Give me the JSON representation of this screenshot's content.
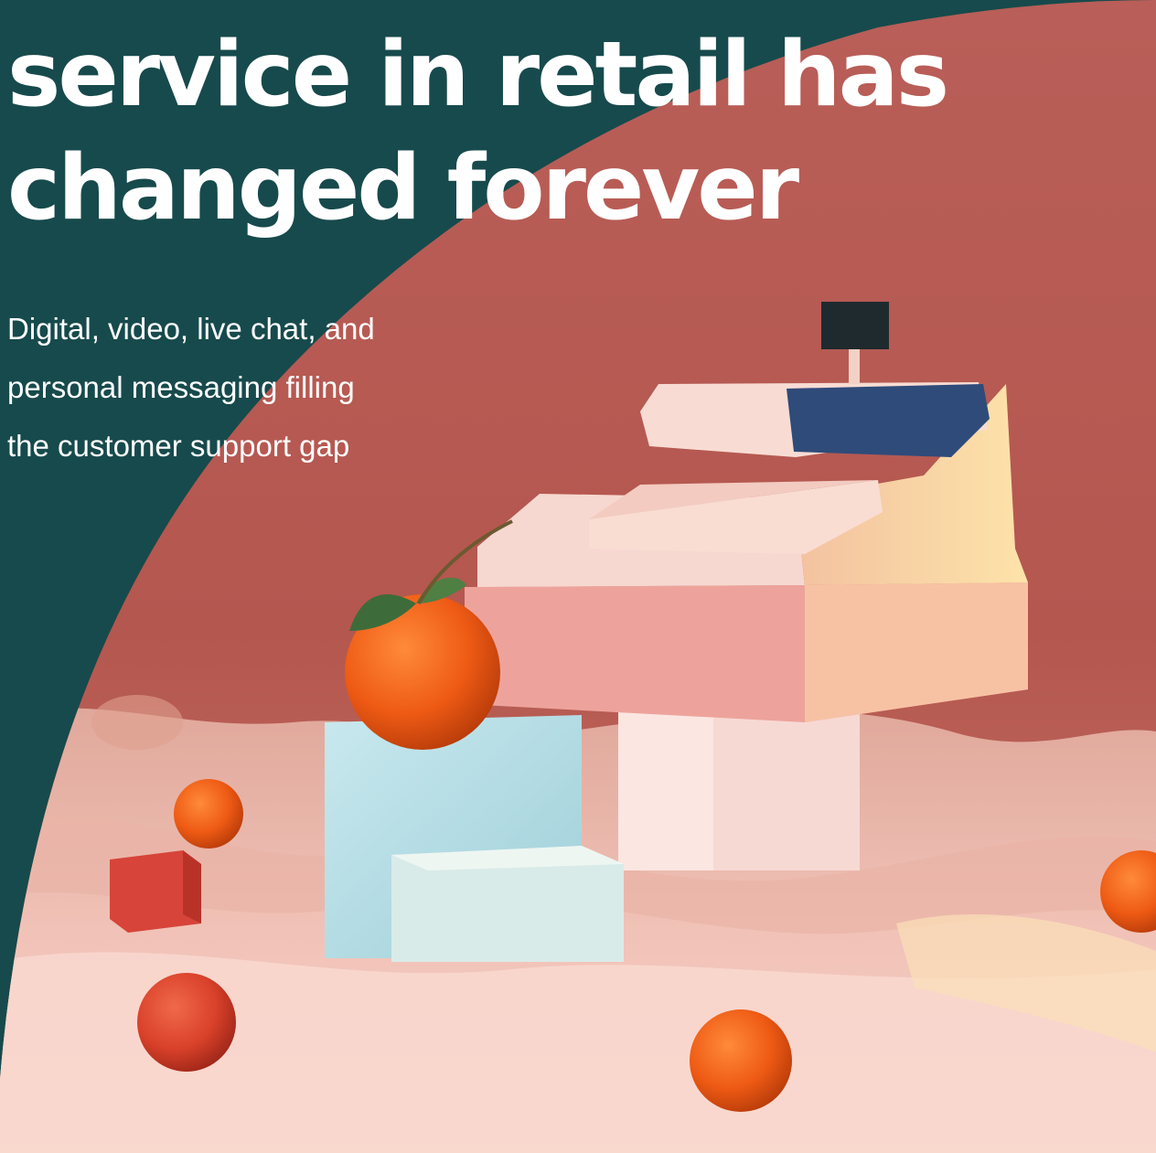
{
  "hero": {
    "headline": [
      "service in retail has",
      "changed forever"
    ],
    "subhead": [
      "Digital, video, live chat, and",
      "personal messaging filling",
      "the customer support gap"
    ]
  },
  "colors": {
    "background": "#174a4c",
    "headline": "#ffffff",
    "wall": "#b85c55",
    "fabric": "#f3c3b8"
  },
  "illustration": {
    "subject": "paper-cash-register-still-life"
  }
}
